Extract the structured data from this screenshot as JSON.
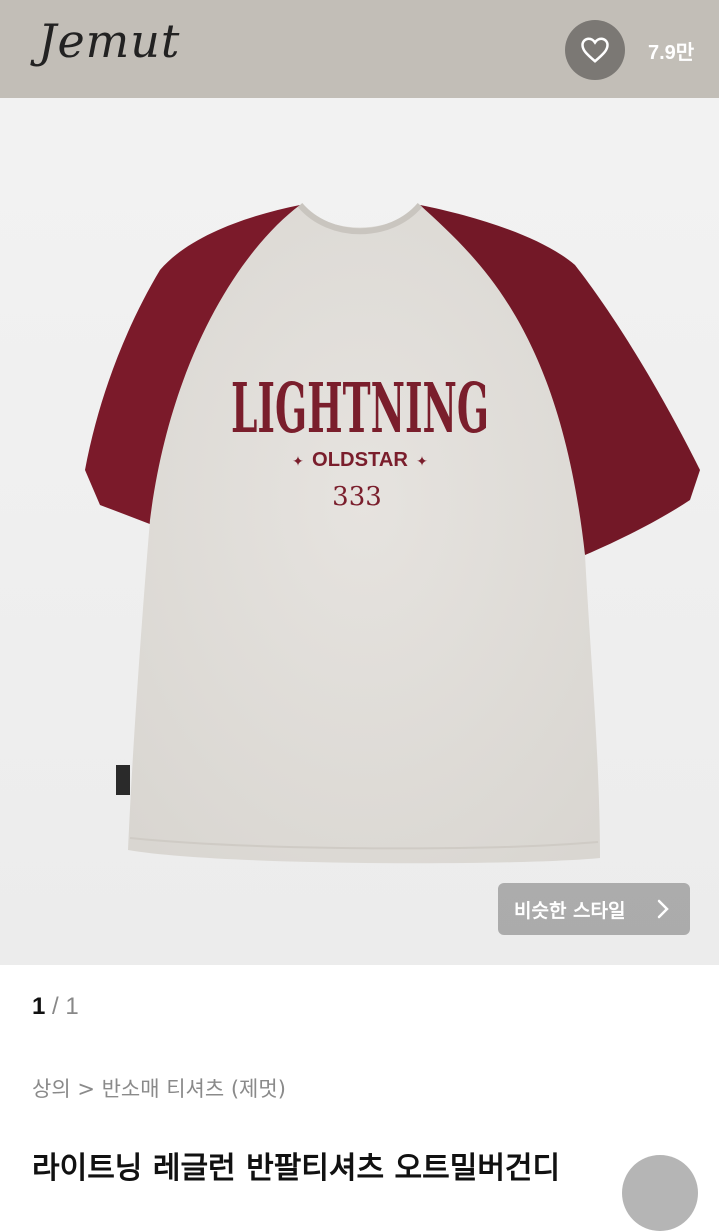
{
  "header": {
    "logo": "Jemut",
    "like_count": "7.9만"
  },
  "product_image": {
    "shirt_print": {
      "line1": "LIGHTNING",
      "line2": "OLDSTAR",
      "line3": "333"
    },
    "colors": {
      "sleeve": "#7b1a2a",
      "body": "#e4e1dc",
      "print": "#7a1e2c"
    },
    "similar_style_label": "비슷한 스타일"
  },
  "pager": {
    "current": "1",
    "separator": "/",
    "total": "1"
  },
  "breadcrumb": "상의 > 반소매 티셔츠 (제멋)",
  "product_title": "라이트닝 레글런 반팔티셔츠 오트밀버건디"
}
